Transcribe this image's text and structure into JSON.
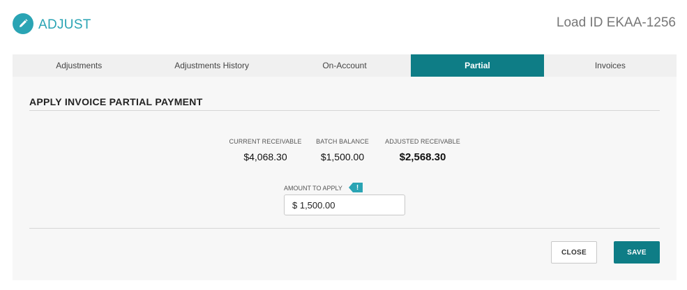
{
  "header": {
    "title": "ADJUST",
    "load_id": "Load ID EKAA-1256",
    "logo_icon": "pencil-icon",
    "accent_color": "#2aa4b4"
  },
  "tabs": [
    {
      "label": "Adjustments",
      "active": false
    },
    {
      "label": "Adjustments History",
      "active": false
    },
    {
      "label": "On-Account",
      "active": false
    },
    {
      "label": "Partial",
      "active": true
    },
    {
      "label": "Invoices",
      "active": false
    }
  ],
  "section": {
    "title": "APPLY INVOICE PARTIAL PAYMENT"
  },
  "stats": {
    "current_receivable": {
      "label": "CURRENT RECEIVABLE",
      "value": "$4,068.30"
    },
    "batch_balance": {
      "label": "BATCH BALANCE",
      "value": "$1,500.00"
    },
    "adjusted_receivable": {
      "label": "ADJUSTED RECEIVABLE",
      "value": "$2,568.30"
    }
  },
  "amount": {
    "label": "AMOUNT TO APPLY",
    "info_glyph": "!",
    "value": "$ 1,500.00"
  },
  "buttons": {
    "close_label": "CLOSE",
    "save_label": "SAVE"
  },
  "colors": {
    "primary": "#0e7d86",
    "accent": "#2aa4b4"
  }
}
